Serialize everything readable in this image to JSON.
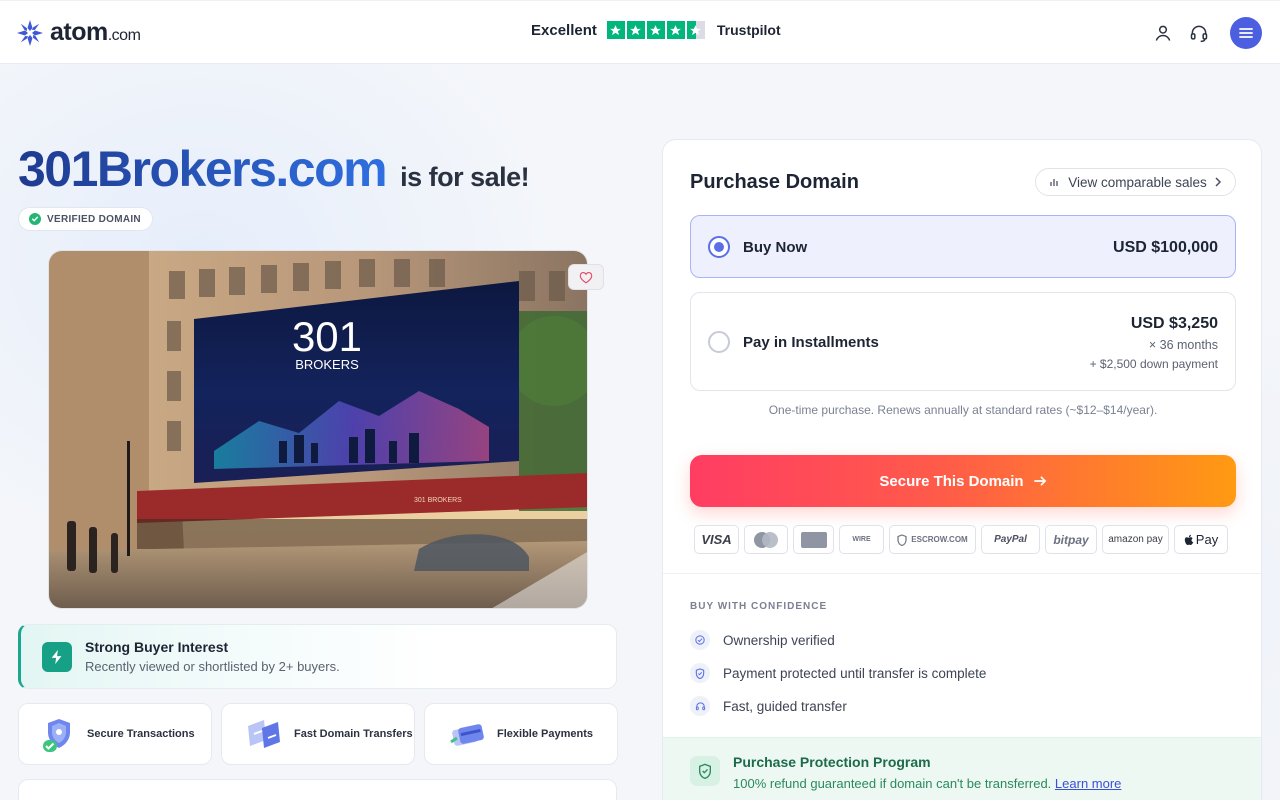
{
  "header": {
    "logo_main": "atom",
    "logo_suffix": ".com",
    "trustpilot_rating": "Excellent",
    "trustpilot_stars": 4.5,
    "trustpilot_name": "Trustpilot"
  },
  "listing": {
    "domain": "301Brokers.com",
    "for_sale": "is for sale!",
    "verified_badge": "VERIFIED DOMAIN",
    "billboard_line1": "301",
    "billboard_line2": "BROKERS",
    "awning_text": "301 BROKERS"
  },
  "interest": {
    "title": "Strong Buyer Interest",
    "subtitle": "Recently viewed or shortlisted by 2+ buyers."
  },
  "features": [
    {
      "label": "Secure Transactions"
    },
    {
      "label": "Fast Domain Transfers"
    },
    {
      "label": "Flexible Payments"
    }
  ],
  "purchase": {
    "title": "Purchase Domain",
    "comparable_label": "View comparable sales",
    "buy_now": {
      "label": "Buy Now",
      "price": "USD $100,000",
      "selected": true
    },
    "installments": {
      "label": "Pay in Installments",
      "price": "USD $3,250",
      "term": "× 36 months",
      "down": "+ $2,500 down payment",
      "selected": false
    },
    "note": "One-time purchase. Renews annually at standard rates (~$12–$14/year).",
    "cta": "Secure This Domain",
    "payment_methods": [
      "VISA",
      "MasterCard",
      "AMEX",
      "WIRE",
      "ESCROW.COM",
      "PayPal",
      "bitpay",
      "amazon pay",
      "Pay"
    ]
  },
  "confidence": {
    "heading": "BUY WITH CONFIDENCE",
    "items": [
      "Ownership verified",
      "Payment protected until transfer is complete",
      "Fast, guided transfer"
    ]
  },
  "protection": {
    "title": "Purchase Protection Program",
    "text": "100% refund guaranteed if domain can't be transferred.",
    "link": "Learn more"
  },
  "colors": {
    "accent": "#4b5fe0",
    "trustpilot": "#00b67a",
    "cta_start": "#ff3d63",
    "cta_end": "#ff9a12",
    "success": "#16a085"
  }
}
